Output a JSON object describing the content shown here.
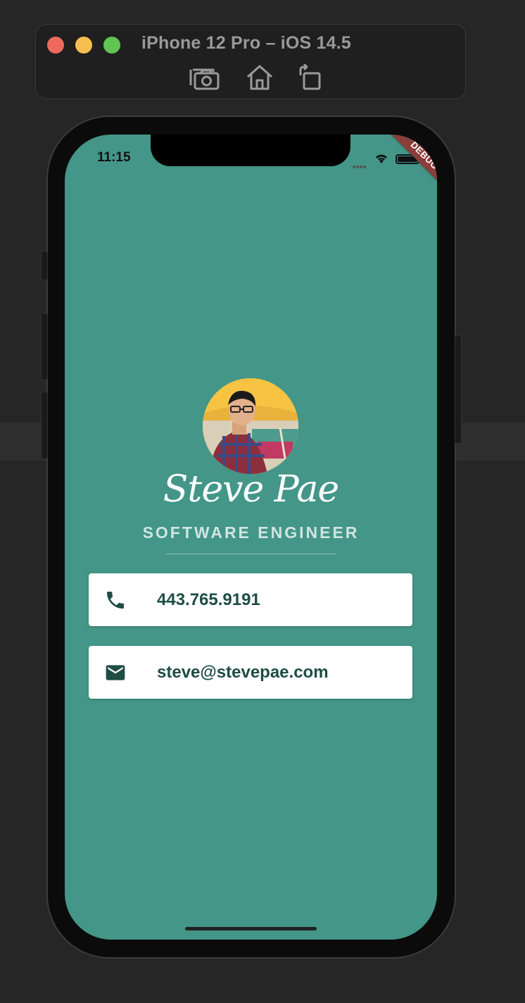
{
  "simulator": {
    "title": "iPhone 12 Pro – iOS 14.5",
    "toolbar_icons": [
      "screenshot-icon",
      "home-icon",
      "rotate-icon"
    ]
  },
  "status_bar": {
    "time": "11:15",
    "debug_banner": "DEBUG"
  },
  "profile": {
    "name": "Steve Pae",
    "title": "SOFTWARE ENGINEER"
  },
  "contacts": [
    {
      "icon": "phone-icon",
      "value": "443.765.9191"
    },
    {
      "icon": "email-icon",
      "value": "steve@stevepae.com"
    }
  ],
  "colors": {
    "screen_background": "#439688",
    "card_background": "#ffffff",
    "card_text": "#1e4d44",
    "debug_banner": "#8a3d3b"
  }
}
